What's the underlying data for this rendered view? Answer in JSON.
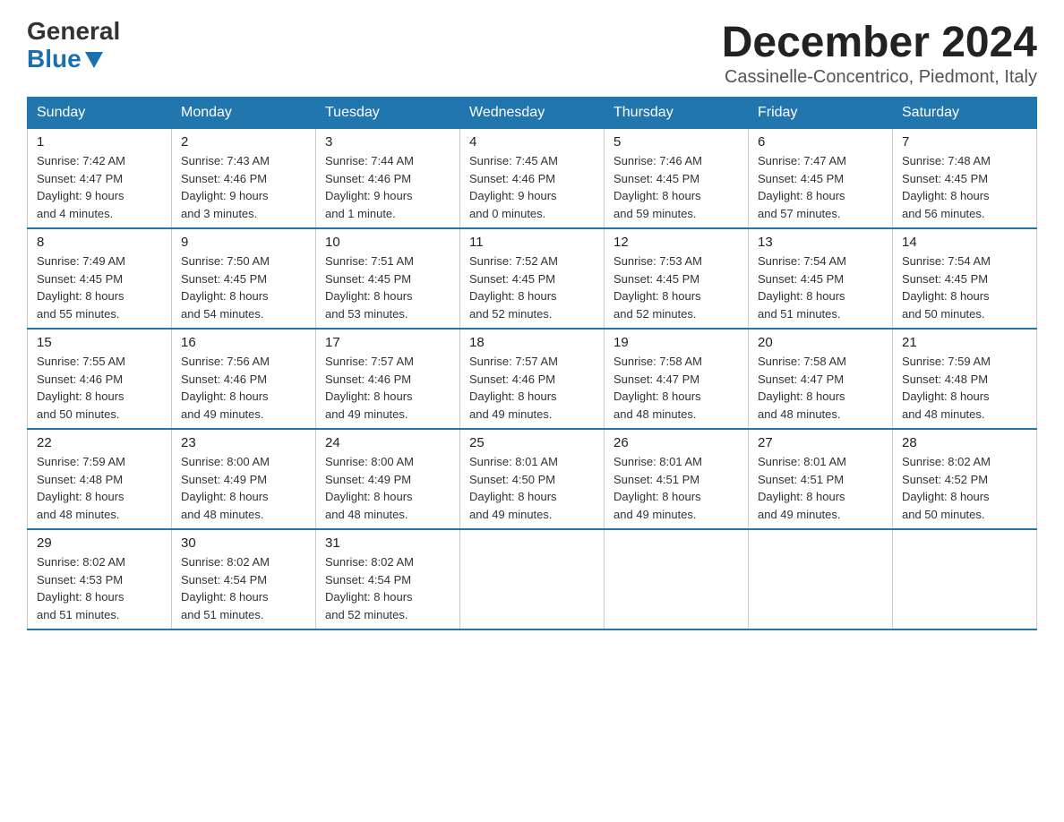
{
  "logo": {
    "general": "General",
    "blue": "Blue"
  },
  "title": "December 2024",
  "subtitle": "Cassinelle-Concentrico, Piedmont, Italy",
  "headers": [
    "Sunday",
    "Monday",
    "Tuesday",
    "Wednesday",
    "Thursday",
    "Friday",
    "Saturday"
  ],
  "weeks": [
    [
      {
        "day": "1",
        "info": "Sunrise: 7:42 AM\nSunset: 4:47 PM\nDaylight: 9 hours\nand 4 minutes."
      },
      {
        "day": "2",
        "info": "Sunrise: 7:43 AM\nSunset: 4:46 PM\nDaylight: 9 hours\nand 3 minutes."
      },
      {
        "day": "3",
        "info": "Sunrise: 7:44 AM\nSunset: 4:46 PM\nDaylight: 9 hours\nand 1 minute."
      },
      {
        "day": "4",
        "info": "Sunrise: 7:45 AM\nSunset: 4:46 PM\nDaylight: 9 hours\nand 0 minutes."
      },
      {
        "day": "5",
        "info": "Sunrise: 7:46 AM\nSunset: 4:45 PM\nDaylight: 8 hours\nand 59 minutes."
      },
      {
        "day": "6",
        "info": "Sunrise: 7:47 AM\nSunset: 4:45 PM\nDaylight: 8 hours\nand 57 minutes."
      },
      {
        "day": "7",
        "info": "Sunrise: 7:48 AM\nSunset: 4:45 PM\nDaylight: 8 hours\nand 56 minutes."
      }
    ],
    [
      {
        "day": "8",
        "info": "Sunrise: 7:49 AM\nSunset: 4:45 PM\nDaylight: 8 hours\nand 55 minutes."
      },
      {
        "day": "9",
        "info": "Sunrise: 7:50 AM\nSunset: 4:45 PM\nDaylight: 8 hours\nand 54 minutes."
      },
      {
        "day": "10",
        "info": "Sunrise: 7:51 AM\nSunset: 4:45 PM\nDaylight: 8 hours\nand 53 minutes."
      },
      {
        "day": "11",
        "info": "Sunrise: 7:52 AM\nSunset: 4:45 PM\nDaylight: 8 hours\nand 52 minutes."
      },
      {
        "day": "12",
        "info": "Sunrise: 7:53 AM\nSunset: 4:45 PM\nDaylight: 8 hours\nand 52 minutes."
      },
      {
        "day": "13",
        "info": "Sunrise: 7:54 AM\nSunset: 4:45 PM\nDaylight: 8 hours\nand 51 minutes."
      },
      {
        "day": "14",
        "info": "Sunrise: 7:54 AM\nSunset: 4:45 PM\nDaylight: 8 hours\nand 50 minutes."
      }
    ],
    [
      {
        "day": "15",
        "info": "Sunrise: 7:55 AM\nSunset: 4:46 PM\nDaylight: 8 hours\nand 50 minutes."
      },
      {
        "day": "16",
        "info": "Sunrise: 7:56 AM\nSunset: 4:46 PM\nDaylight: 8 hours\nand 49 minutes."
      },
      {
        "day": "17",
        "info": "Sunrise: 7:57 AM\nSunset: 4:46 PM\nDaylight: 8 hours\nand 49 minutes."
      },
      {
        "day": "18",
        "info": "Sunrise: 7:57 AM\nSunset: 4:46 PM\nDaylight: 8 hours\nand 49 minutes."
      },
      {
        "day": "19",
        "info": "Sunrise: 7:58 AM\nSunset: 4:47 PM\nDaylight: 8 hours\nand 48 minutes."
      },
      {
        "day": "20",
        "info": "Sunrise: 7:58 AM\nSunset: 4:47 PM\nDaylight: 8 hours\nand 48 minutes."
      },
      {
        "day": "21",
        "info": "Sunrise: 7:59 AM\nSunset: 4:48 PM\nDaylight: 8 hours\nand 48 minutes."
      }
    ],
    [
      {
        "day": "22",
        "info": "Sunrise: 7:59 AM\nSunset: 4:48 PM\nDaylight: 8 hours\nand 48 minutes."
      },
      {
        "day": "23",
        "info": "Sunrise: 8:00 AM\nSunset: 4:49 PM\nDaylight: 8 hours\nand 48 minutes."
      },
      {
        "day": "24",
        "info": "Sunrise: 8:00 AM\nSunset: 4:49 PM\nDaylight: 8 hours\nand 48 minutes."
      },
      {
        "day": "25",
        "info": "Sunrise: 8:01 AM\nSunset: 4:50 PM\nDaylight: 8 hours\nand 49 minutes."
      },
      {
        "day": "26",
        "info": "Sunrise: 8:01 AM\nSunset: 4:51 PM\nDaylight: 8 hours\nand 49 minutes."
      },
      {
        "day": "27",
        "info": "Sunrise: 8:01 AM\nSunset: 4:51 PM\nDaylight: 8 hours\nand 49 minutes."
      },
      {
        "day": "28",
        "info": "Sunrise: 8:02 AM\nSunset: 4:52 PM\nDaylight: 8 hours\nand 50 minutes."
      }
    ],
    [
      {
        "day": "29",
        "info": "Sunrise: 8:02 AM\nSunset: 4:53 PM\nDaylight: 8 hours\nand 51 minutes."
      },
      {
        "day": "30",
        "info": "Sunrise: 8:02 AM\nSunset: 4:54 PM\nDaylight: 8 hours\nand 51 minutes."
      },
      {
        "day": "31",
        "info": "Sunrise: 8:02 AM\nSunset: 4:54 PM\nDaylight: 8 hours\nand 52 minutes."
      },
      {
        "day": "",
        "info": ""
      },
      {
        "day": "",
        "info": ""
      },
      {
        "day": "",
        "info": ""
      },
      {
        "day": "",
        "info": ""
      }
    ]
  ]
}
